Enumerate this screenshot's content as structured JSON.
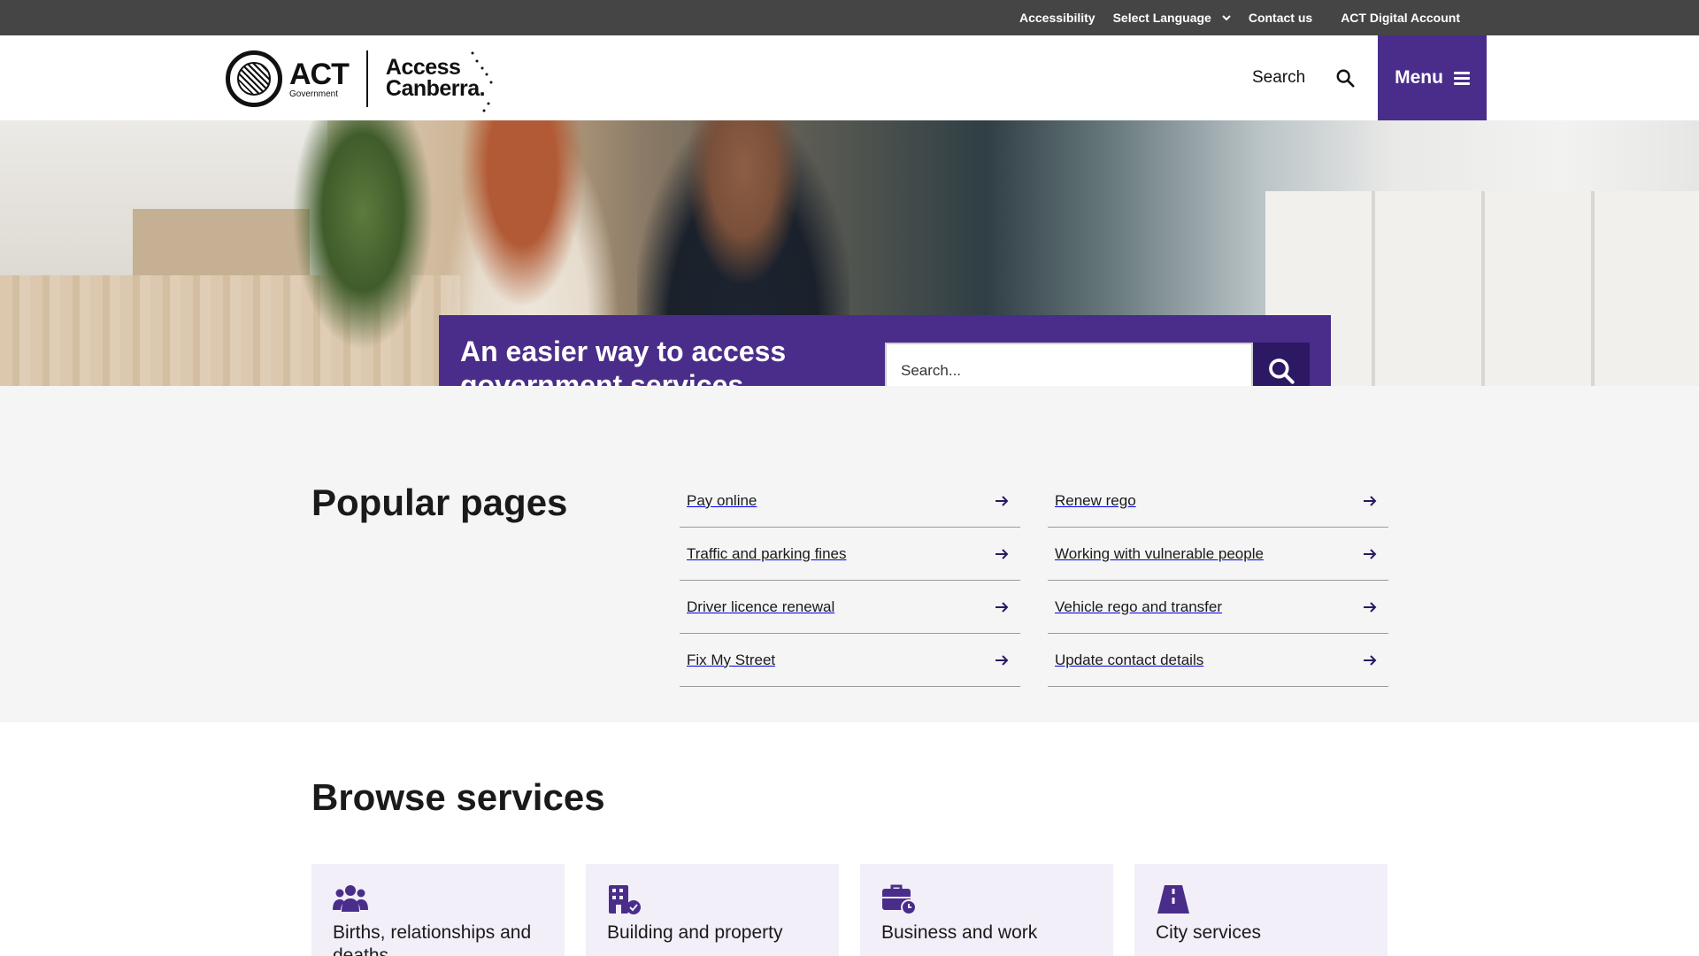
{
  "utility_bar": {
    "accessibility": "Accessibility",
    "select_language": "Select Language",
    "contact_us": "Contact us",
    "digital_account": "ACT Digital Account"
  },
  "header": {
    "act_logo_main": "ACT",
    "act_logo_sub": "Government",
    "access_line1": "Access",
    "access_line2": "Canberra.",
    "search_label": "Search",
    "menu_label": "Menu"
  },
  "hero": {
    "title": "An easier way to access government services",
    "search_placeholder": "Search..."
  },
  "popular": {
    "title": "Popular pages",
    "column1": [
      "Pay online",
      "Traffic and parking fines",
      "Driver licence renewal",
      "Fix My Street"
    ],
    "column2": [
      "Renew rego",
      "Working with vulnerable people",
      "Vehicle rego and transfer",
      "Update contact details"
    ]
  },
  "browse": {
    "title": "Browse services",
    "cards": [
      {
        "label": "Births, relationships and deaths",
        "icon": "people-group-icon"
      },
      {
        "label": "Building and property",
        "icon": "building-check-icon"
      },
      {
        "label": "Business and work",
        "icon": "briefcase-clock-icon"
      },
      {
        "label": "City services",
        "icon": "road-icon"
      }
    ]
  },
  "colors": {
    "brand_purple": "#4a2d8a",
    "dark_purple": "#2c1863",
    "utility_bg": "#454545",
    "card_bg": "#f2eff9",
    "section_bg": "#f5f5f5"
  }
}
